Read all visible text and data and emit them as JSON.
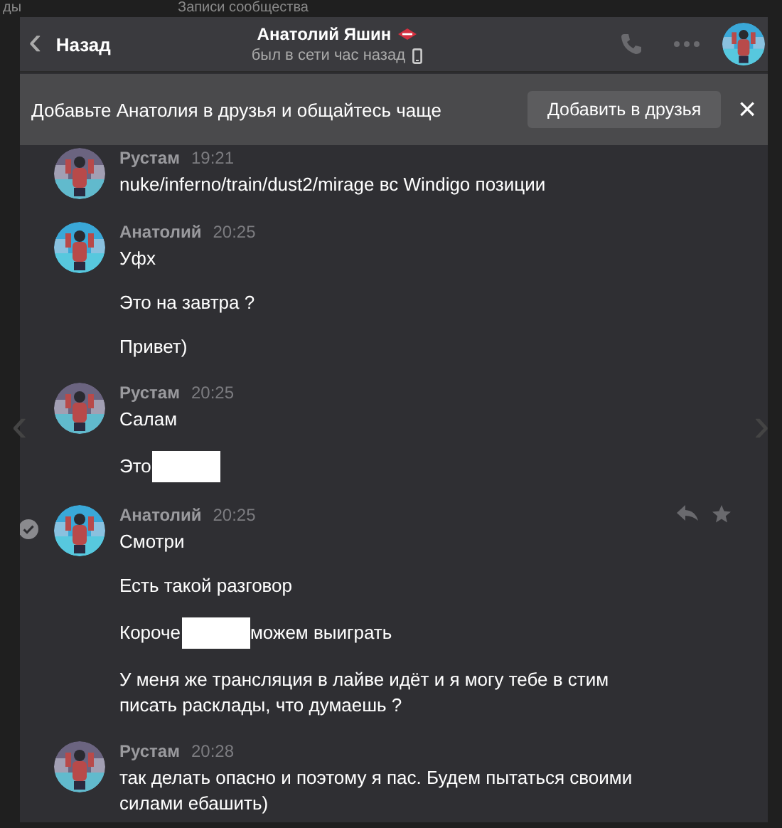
{
  "background": {
    "texts": [
      "ды",
      "Записи сообщества"
    ]
  },
  "nav": {
    "previous": "‹",
    "next": "›"
  },
  "header": {
    "back": {
      "icon": "‹",
      "label": "Назад"
    },
    "title": "Анатолий Яшин",
    "status": "был в сети час назад",
    "avatar": {
      "kind": "picture",
      "color": "#3aa8d8"
    }
  },
  "friend_bar": {
    "text": "Добавьте Анатолия в друзья и общайтесь чаще",
    "button": "Добавить в друзья",
    "close": "×"
  },
  "messages": [
    {
      "author": "Рустам",
      "time": "19:21",
      "avatar": {
        "kind": "picture",
        "color": "#6b6480"
      },
      "selected": false,
      "hovered": false,
      "paragraphs": [
        [
          {
            "kind": "text",
            "text": "nuke/inferno/train/dust2/mirage вс Windigo позиции"
          }
        ]
      ]
    },
    {
      "author": "Анатолий",
      "time": "20:25",
      "avatar": {
        "kind": "picture",
        "color": "#3aa8d8"
      },
      "selected": false,
      "hovered": false,
      "paragraphs": [
        [
          {
            "kind": "text",
            "text": "Уфх"
          }
        ],
        [
          {
            "kind": "text",
            "text": "Это на завтра ?"
          }
        ],
        [
          {
            "kind": "text",
            "text": "Привет)"
          }
        ]
      ]
    },
    {
      "author": "Рустам",
      "time": "20:25",
      "avatar": {
        "kind": "picture",
        "color": "#6b6480"
      },
      "selected": false,
      "hovered": false,
      "paragraphs": [
        [
          {
            "kind": "text",
            "text": "Салам"
          }
        ],
        [
          {
            "kind": "text",
            "text": "Это"
          },
          {
            "kind": "redacted"
          }
        ]
      ]
    },
    {
      "author": "Анатолий",
      "time": "20:25",
      "avatar": {
        "kind": "picture",
        "color": "#3aa8d8"
      },
      "selected": true,
      "hovered": true,
      "paragraphs": [
        [
          {
            "kind": "text",
            "text": "Смотри"
          }
        ],
        [
          {
            "kind": "text",
            "text": "Есть такой разговор"
          }
        ],
        [
          {
            "kind": "text",
            "text": "Короче"
          },
          {
            "kind": "redacted"
          },
          {
            "kind": "text",
            "text": "можем выиграть"
          }
        ],
        [
          {
            "kind": "text",
            "text": "У меня же трансляция в лайве идёт и я могу тебе в стим писать расклады, что думаешь ?"
          }
        ]
      ]
    },
    {
      "author": "Рустам",
      "time": "20:28",
      "avatar": {
        "kind": "picture",
        "color": "#6b6480"
      },
      "selected": false,
      "hovered": false,
      "paragraphs": [
        [
          {
            "kind": "text",
            "text": "так делать опасно и поэтому я пас. Будем пытаться своими силами ебашить)"
          }
        ]
      ]
    }
  ]
}
